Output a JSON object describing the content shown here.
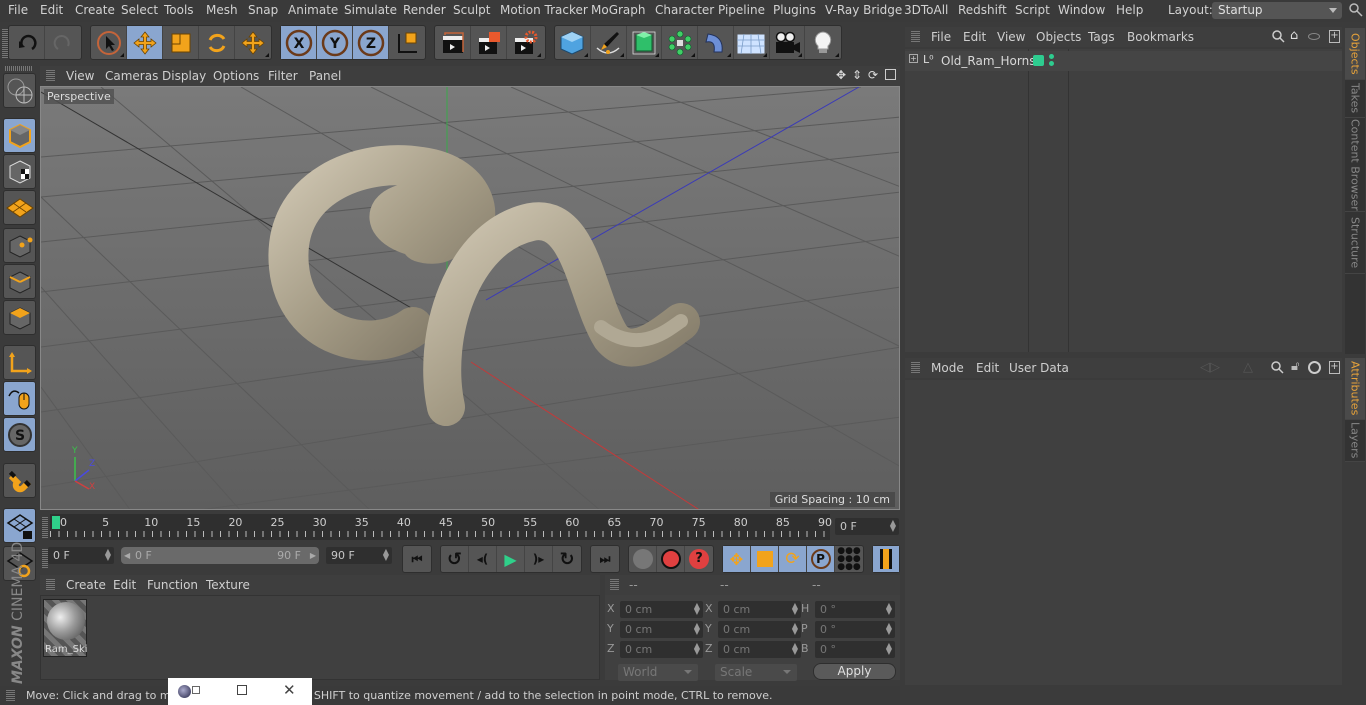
{
  "menubar": {
    "items": [
      "File",
      "Edit",
      "Create",
      "Select",
      "Tools",
      "Mesh",
      "Snap",
      "Animate",
      "Simulate",
      "Render",
      "Sculpt",
      "Motion Tracker",
      "MoGraph",
      "Character",
      "Pipeline",
      "Plugins",
      "V-Ray Bridge",
      "3DToAll",
      "Redshift",
      "Script",
      "Window",
      "Help"
    ],
    "layout_label": "Layout:",
    "layout_value": "Startup"
  },
  "toolbar": {
    "icons": [
      "undo-icon",
      "redo-icon",
      "live-selection-icon",
      "move-icon",
      "scale-icon",
      "rotate-icon",
      "recent-tool-icon",
      "x-axis-icon",
      "y-axis-icon",
      "z-axis-icon",
      "coordinate-system-icon",
      "render-view-icon",
      "render-picture-viewer-icon",
      "render-settings-icon",
      "cube-icon",
      "pen-icon",
      "subdivision-icon",
      "cloner-icon",
      "deformer-icon",
      "floor-icon",
      "camera-icon",
      "light-icon"
    ]
  },
  "viewport": {
    "menu": [
      "View",
      "Cameras",
      "Display",
      "Options",
      "Filter",
      "Panel"
    ],
    "camera_label": "Perspective",
    "grid_spacing": "Grid Spacing : 10 cm",
    "axis_labels": {
      "x": "X",
      "y": "Y",
      "z": "Z"
    }
  },
  "timeline": {
    "ticks": [
      "0",
      "5",
      "10",
      "15",
      "20",
      "25",
      "30",
      "35",
      "40",
      "45",
      "50",
      "55",
      "60",
      "65",
      "70",
      "75",
      "80",
      "85",
      "90"
    ],
    "current_frame": "0 F",
    "start_frame": "0 F",
    "range_start": "0 F",
    "range_end": "90 F",
    "end_frame": "90 F"
  },
  "material_manager": {
    "menu": [
      "Create",
      "Edit",
      "Function",
      "Texture"
    ],
    "materials": [
      {
        "name": "Ram_Ski"
      }
    ]
  },
  "coordinates": {
    "headers": [
      "--",
      "--",
      "--"
    ],
    "rows": [
      {
        "l1": "X",
        "v1": "0 cm",
        "l2": "X",
        "v2": "0 cm",
        "l3": "H",
        "v3": "0 °"
      },
      {
        "l1": "Y",
        "v1": "0 cm",
        "l2": "Y",
        "v2": "0 cm",
        "l3": "P",
        "v3": "0 °"
      },
      {
        "l1": "Z",
        "v1": "0 cm",
        "l2": "Z",
        "v2": "0 cm",
        "l3": "B",
        "v3": "0 °"
      }
    ],
    "space": "World",
    "mode": "Scale",
    "apply_label": "Apply"
  },
  "status": {
    "text": "Move: Click and drag to move elements. Hold down SHIFT to quantize movement / add to the selection in point mode, CTRL to remove."
  },
  "object_manager": {
    "menu": [
      "File",
      "Edit",
      "View",
      "Objects",
      "Tags",
      "Bookmarks"
    ],
    "objects": [
      {
        "name": "Old_Ram_Horns",
        "color": "#2ecc8f"
      }
    ]
  },
  "attribute_manager": {
    "menu": [
      "Mode",
      "Edit",
      "User Data"
    ]
  },
  "side_tabs_top": [
    "Objects",
    "Takes",
    "Content Browser",
    "Structure"
  ],
  "side_tabs_bottom": [
    "Attributes",
    "Layers"
  ],
  "brand": {
    "maxon": "MAXON",
    "product": "CINEMA 4D"
  },
  "colors": {
    "accent": "#8aa6cf",
    "active_tab": "#e8a33a",
    "object_tag": "#2ecc8f"
  }
}
